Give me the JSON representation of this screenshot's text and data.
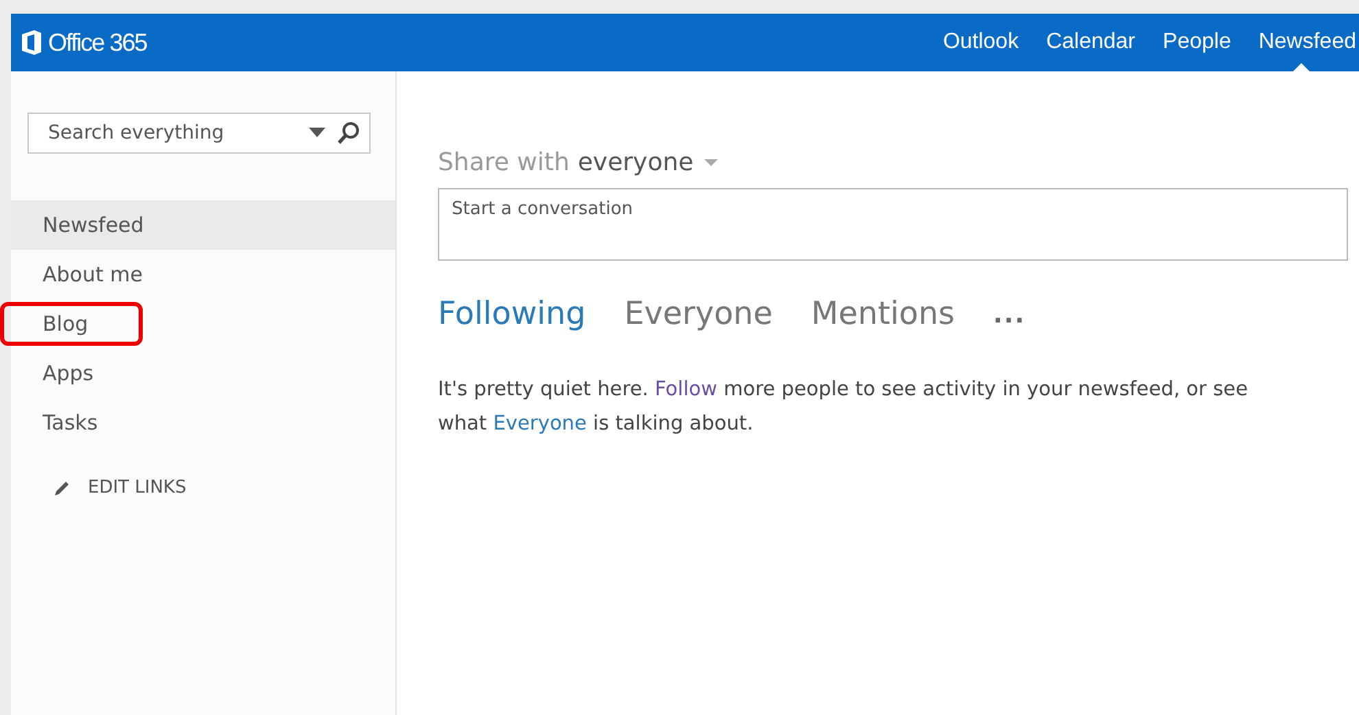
{
  "app_bar": {
    "logo_text": "Office 365",
    "nav": [
      {
        "label": "Outlook",
        "selected": false
      },
      {
        "label": "Calendar",
        "selected": false
      },
      {
        "label": "People",
        "selected": false
      },
      {
        "label": "Newsfeed",
        "selected": true
      }
    ]
  },
  "sidebar": {
    "search": {
      "placeholder": "Search everything"
    },
    "items": [
      {
        "label": "Newsfeed",
        "selected": true,
        "highlighted": false
      },
      {
        "label": "About me",
        "selected": false,
        "highlighted": false
      },
      {
        "label": "Blog",
        "selected": false,
        "highlighted": true
      },
      {
        "label": "Apps",
        "selected": false,
        "highlighted": false
      },
      {
        "label": "Tasks",
        "selected": false,
        "highlighted": false
      }
    ],
    "edit_links": "EDIT LINKS"
  },
  "share": {
    "label": "Share with",
    "audience": "everyone",
    "placeholder": "Start a conversation"
  },
  "feed_tabs": [
    {
      "label": "Following",
      "selected": true
    },
    {
      "label": "Everyone",
      "selected": false
    },
    {
      "label": "Mentions",
      "selected": false
    }
  ],
  "more": "...",
  "message": [
    {
      "kind": "text",
      "text": "It's pretty quiet here. "
    },
    {
      "kind": "link",
      "text": "Follow",
      "color": "#6a4fa0"
    },
    {
      "kind": "text",
      "text": " more people to see activity in your newsfeed, or see what "
    },
    {
      "kind": "link",
      "text": "Everyone",
      "color": "#2a7ab8"
    },
    {
      "kind": "text",
      "text": " is talking about."
    }
  ]
}
